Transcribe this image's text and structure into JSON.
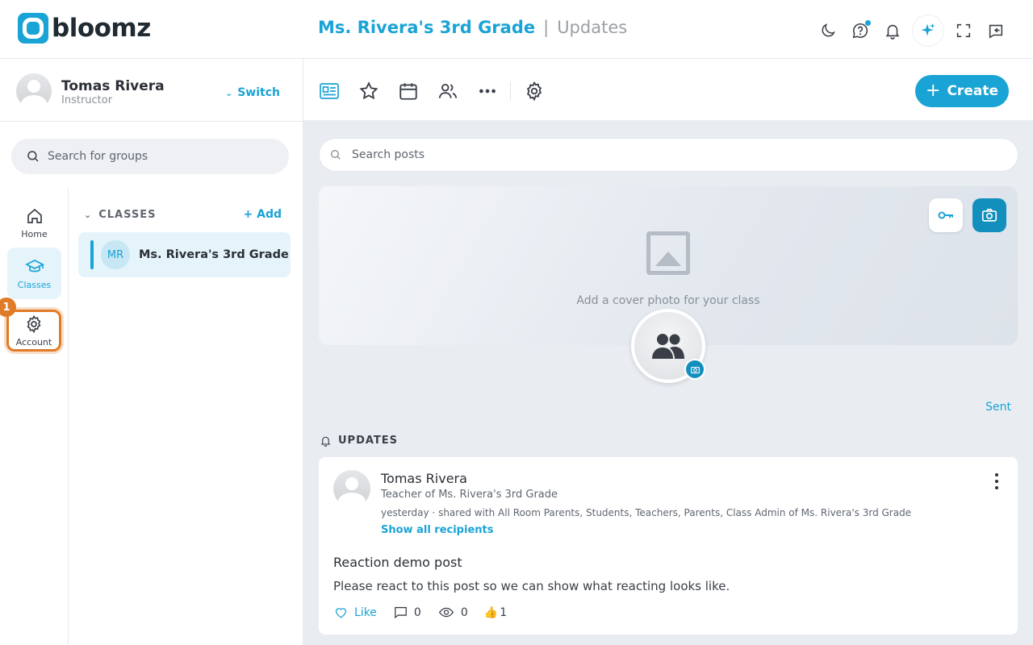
{
  "app": {
    "brand": "bloomz"
  },
  "header": {
    "class_name": "Ms. Rivera's 3rd Grade",
    "separator": "|",
    "page": "Updates"
  },
  "user": {
    "name": "Tomas Rivera",
    "role": "Instructor",
    "switch_label": "Switch"
  },
  "group_search": {
    "placeholder": "Search for groups"
  },
  "nav": {
    "home": "Home",
    "classes": "Classes",
    "account": "Account",
    "step_badge": "1"
  },
  "classes": {
    "heading": "CLASSES",
    "add_label": "+ Add",
    "items": [
      {
        "initials": "MR",
        "name": "Ms. Rivera's 3rd Grade"
      }
    ]
  },
  "toolbar": {
    "create_label": "Create",
    "create_icon": "+"
  },
  "post_search": {
    "placeholder": "Search posts"
  },
  "cover": {
    "prompt": "Add a cover photo for your class"
  },
  "feed": {
    "sent_label": "Sent",
    "updates_heading": "UPDATES",
    "posts": [
      {
        "author": "Tomas Rivera",
        "subtitle": "Teacher of Ms. Rivera's 3rd Grade",
        "meta": "yesterday · shared with All Room Parents, Students, Teachers, Parents, Class Admin of Ms. Rivera's 3rd Grade",
        "recipients_link": "Show all recipients",
        "title": "Reaction demo post",
        "body": "Please react to this post so we can show what reacting looks like.",
        "like_label": "Like",
        "comment_count": "0",
        "view_count": "0",
        "reaction_emoji": "👍",
        "reaction_count": "1"
      }
    ]
  },
  "colors": {
    "accent": "#1aa3d5",
    "highlight": "#e07b28",
    "main_bg": "#e9edf2"
  }
}
